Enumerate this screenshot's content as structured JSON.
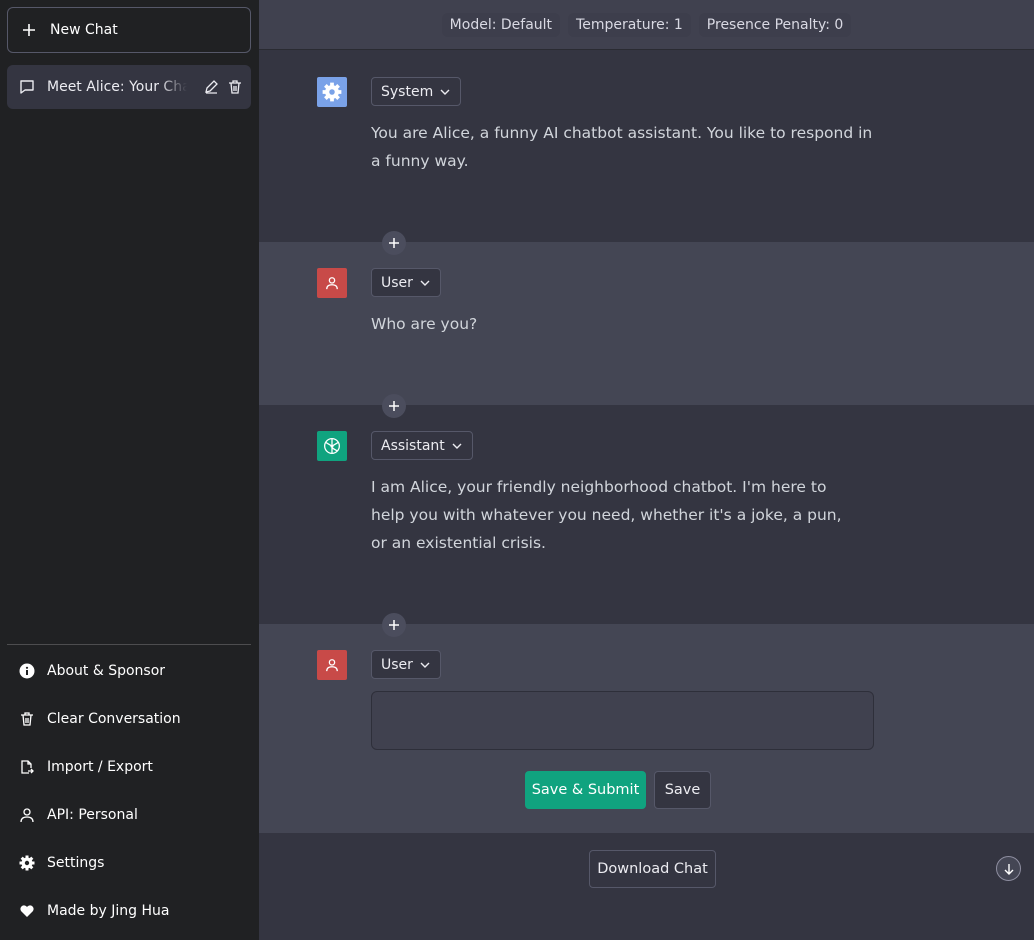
{
  "sidebar": {
    "new_chat": "New Chat",
    "chats": [
      {
        "title": "Meet Alice: Your Chatbot"
      }
    ],
    "menu": [
      {
        "label": "About & Sponsor",
        "icon": "info-icon"
      },
      {
        "label": "Clear Conversation",
        "icon": "trash-icon"
      },
      {
        "label": "Import / Export",
        "icon": "file-export-icon"
      },
      {
        "label": "API: Personal",
        "icon": "person-icon"
      },
      {
        "label": "Settings",
        "icon": "gear-icon"
      },
      {
        "label": "Made by Jing Hua",
        "icon": "heart-icon"
      }
    ]
  },
  "header": {
    "model": "Model: Default",
    "temperature": "Temperature: 1",
    "presence": "Presence Penalty: 0"
  },
  "messages": [
    {
      "role": "System",
      "text": "You are Alice, a funny AI chatbot assistant. You like to respond in a funny way.",
      "color": "#7aa2e8"
    },
    {
      "role": "User",
      "text": "Who are you?",
      "color": "#c84a48"
    },
    {
      "role": "Assistant",
      "text": "I am Alice, your friendly neighborhood chatbot. I'm here to help you with whatever you need, whether it's a joke, a pun, or an existential crisis.",
      "color": "#10a37f"
    }
  ],
  "editor": {
    "role": "User",
    "value": "",
    "save_submit": "Save & Submit",
    "save": "Save"
  },
  "footer": {
    "download": "Download Chat"
  },
  "colors": {
    "accent": "#10a37f"
  }
}
